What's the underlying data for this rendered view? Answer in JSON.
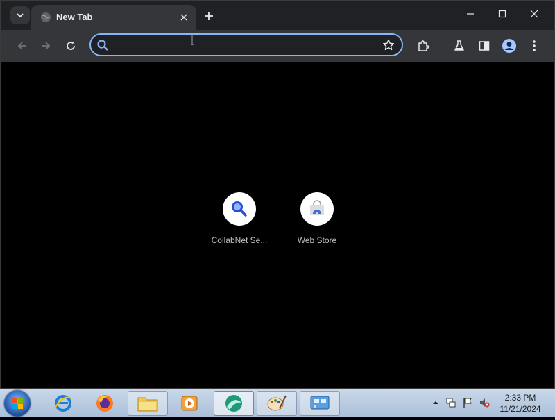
{
  "browser": {
    "tab": {
      "title": "New Tab",
      "favicon": "globe-icon"
    },
    "new_tab_icon": "plus-icon",
    "window_controls": [
      "minimize-icon",
      "maximize-icon",
      "close-icon"
    ]
  },
  "toolbar": {
    "back_icon": "arrow-left-icon",
    "forward_icon": "arrow-right-icon",
    "reload_icon": "reload-icon",
    "omnibox": {
      "value": "",
      "placeholder": ""
    },
    "bookmark_icon": "star-icon",
    "right_icons": [
      "extensions-icon",
      "labs-icon",
      "side-panel-icon",
      "profile-icon",
      "more-icon"
    ]
  },
  "shortcuts": [
    {
      "label": "CollabNet Se...",
      "icon": "magnifier-icon"
    },
    {
      "label": "Web Store",
      "icon": "web-store-icon"
    }
  ],
  "taskbar": {
    "apps": [
      "internet-explorer-icon",
      "firefox-icon",
      "file-explorer-icon",
      "media-player-icon",
      "app-icon",
      "paint-icon",
      "control-panel-icon"
    ],
    "tray_icons": [
      "show-hidden-icon",
      "network-icon",
      "flag-icon",
      "volume-muted-icon"
    ],
    "time": "2:33 PM",
    "date": "11/21/2024"
  },
  "colors": {
    "titlebar": "#202124",
    "toolbar": "#35363a",
    "accent": "#8ab4f8",
    "page_bg": "#000000"
  }
}
